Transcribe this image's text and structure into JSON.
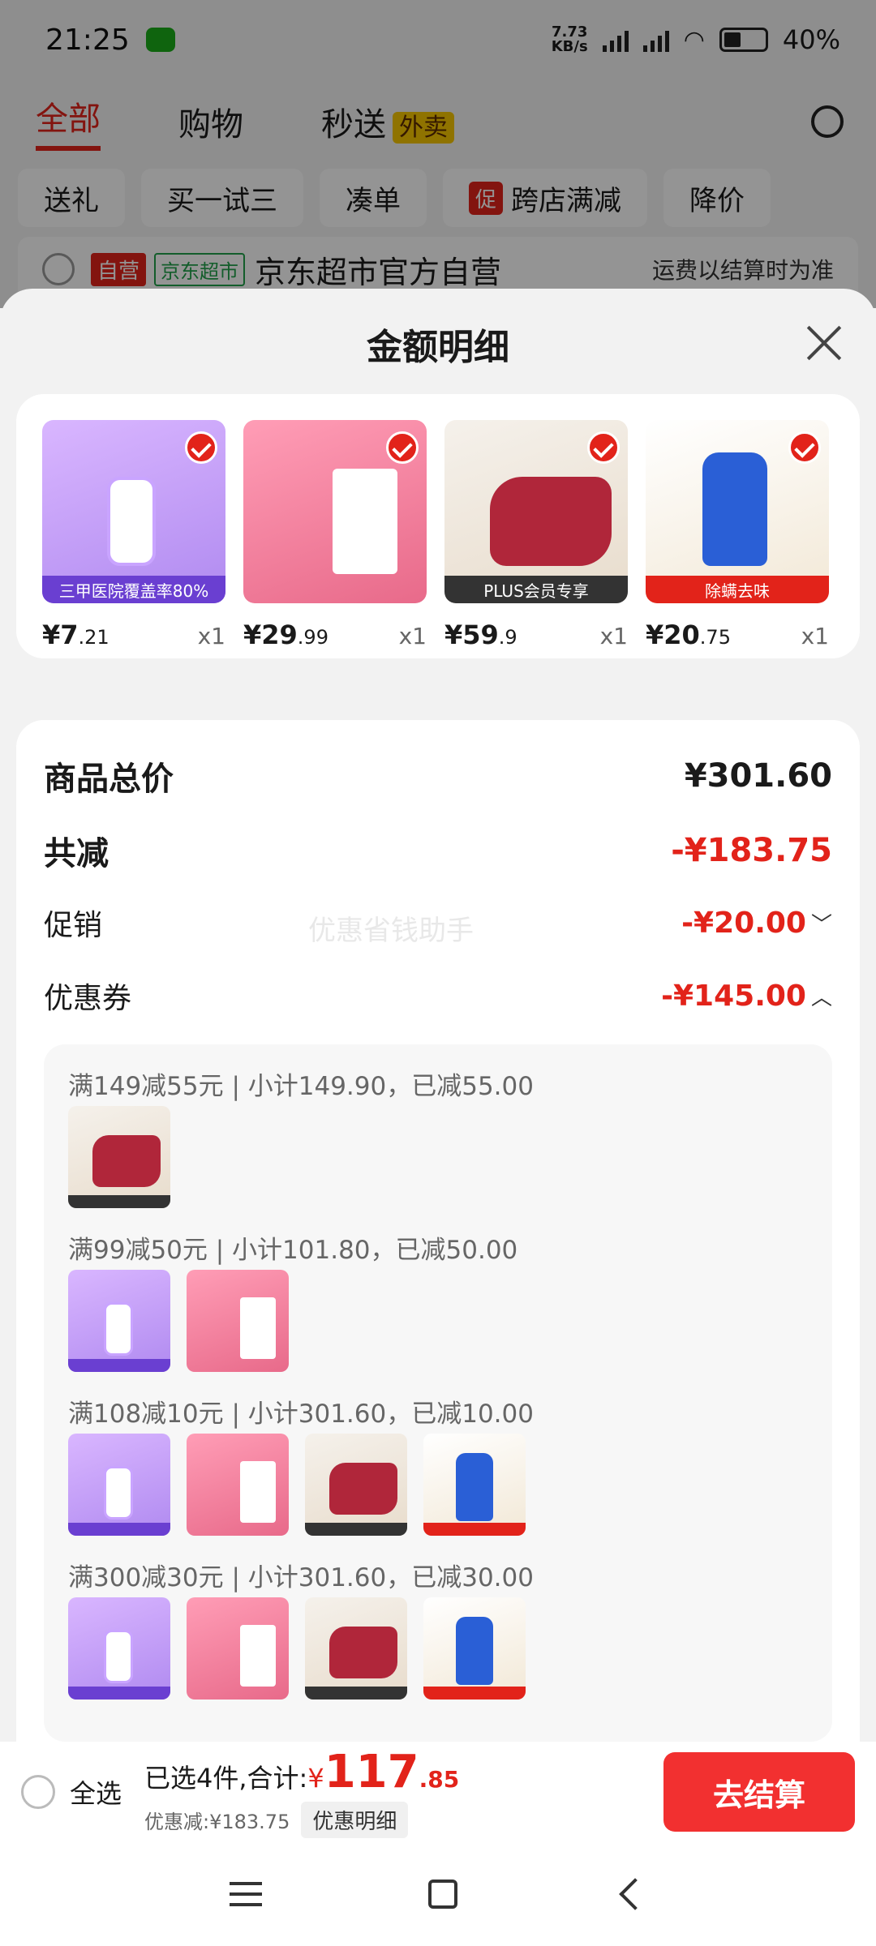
{
  "status": {
    "time": "21:25",
    "speed": "7.73\nKB/s",
    "net1": "5G",
    "net2": "4G",
    "battery": "40%"
  },
  "top_tabs": [
    {
      "label": "全部"
    },
    {
      "label": "购物"
    },
    {
      "label": "秒送"
    }
  ],
  "waimai_badge": "外卖",
  "chips": [
    "送礼",
    "买一试三",
    "凑单",
    "跨店满减",
    "降价"
  ],
  "chip_badge": "促",
  "shop": {
    "tag1": "自营",
    "tag2": "京东超市",
    "name": "京东超市官方自营",
    "freight": "运费以结算时为准"
  },
  "sheet_title": "金额明细",
  "products": [
    {
      "price_int": "¥7",
      "price_dec": ".21",
      "qty": "x1",
      "band": "三甲医院覆盖率80%"
    },
    {
      "price_int": "¥29",
      "price_dec": ".99",
      "qty": "x1",
      "band": ""
    },
    {
      "price_int": "¥59",
      "price_dec": ".9",
      "qty": "x1",
      "band": "PLUS会员专享"
    },
    {
      "price_int": "¥20",
      "price_dec": ".75",
      "qty": "x1",
      "band": "除螨去味"
    }
  ],
  "summary": {
    "total_label": "商品总价",
    "total_value": "¥301.60",
    "reduce_label": "共减",
    "reduce_value": "-¥183.75",
    "promo_label": "促销",
    "promo_value": "-¥20.00",
    "coupon_label": "优惠券",
    "coupon_value": "-¥145.00",
    "watermark": "优惠省钱助手"
  },
  "coupon_groups": [
    {
      "title": "满149减55元 | 小计149.90，已减55.00"
    },
    {
      "title": "满99减50元 | 小计101.80，已减50.00"
    },
    {
      "title": "满108减10元 | 小计301.60，已减10.00"
    },
    {
      "title": "满300减30元 | 小计301.60，已减30.00"
    }
  ],
  "bottom": {
    "select_all": "全选",
    "selected": "已选4件,合计:",
    "yen": "¥",
    "total_int": "117",
    "total_dec": ".85",
    "discount": "优惠减:¥183.75",
    "detail_pill": "优惠明细",
    "checkout": "去结算"
  },
  "colors": {
    "accent": "#e2231a",
    "checkout": "#f23030"
  }
}
